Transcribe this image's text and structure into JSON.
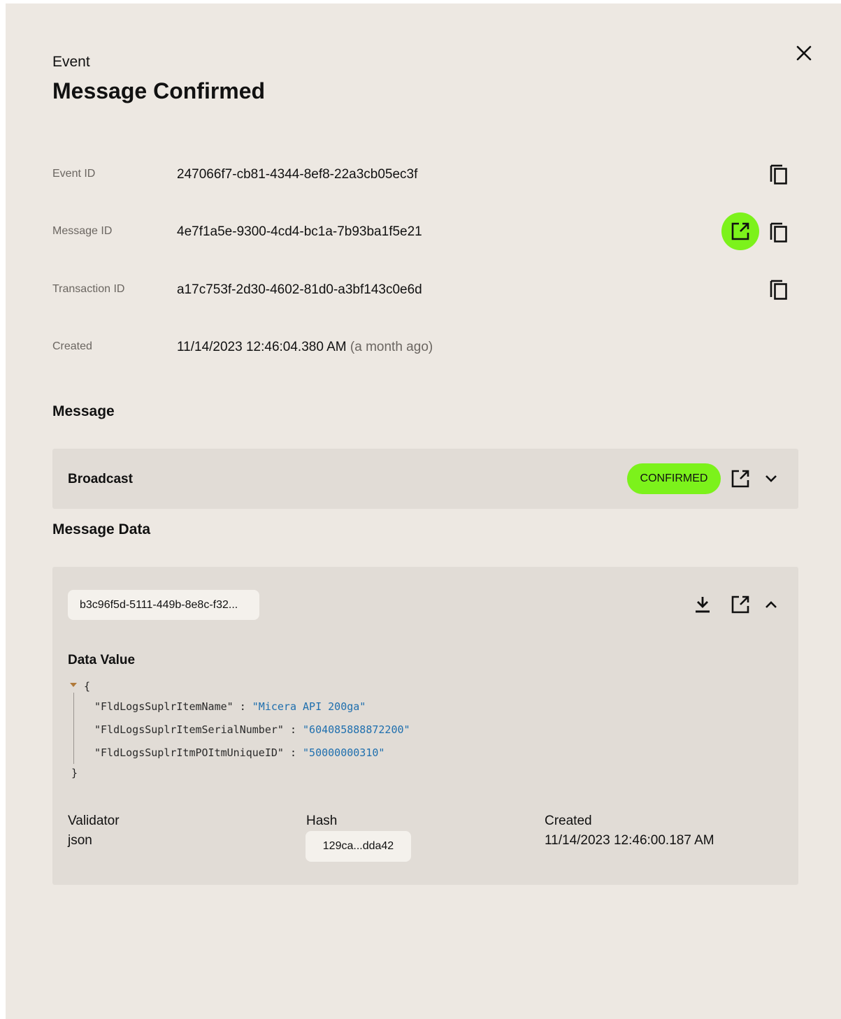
{
  "header": {
    "kicker": "Event",
    "title": "Message Confirmed"
  },
  "details": [
    {
      "label": "Event ID",
      "value": "247066f7-cb81-4344-8ef8-22a3cb05ec3f"
    },
    {
      "label": "Message ID",
      "value": "4e7f1a5e-9300-4cd4-bc1a-7b93ba1f5e21"
    },
    {
      "label": "Transaction ID",
      "value": "a17c753f-2d30-4602-81d0-a3bf143c0e6d"
    },
    {
      "label": "Created",
      "value": "11/14/2023 12:46:04.380 AM",
      "relative": "(a month ago)"
    }
  ],
  "message": {
    "section_title": "Message",
    "type": "Broadcast",
    "status": "CONFIRMED"
  },
  "message_data": {
    "section_title": "Message Data",
    "data_id": "b3c96f5d-5111-449b-8e8c-f32...",
    "data_value_title": "Data Value",
    "json_open": "{",
    "json_close": "}",
    "json_fields": [
      {
        "key": "\"FldLogsSuplrItemName\"",
        "sep": " : ",
        "value": "\"Micera API 200ga\""
      },
      {
        "key": "\"FldLogsSuplrItemSerialNumber\"",
        "sep": " : ",
        "value": "\"604085888872200\""
      },
      {
        "key": "\"FldLogsSuplrItmPOItmUniqueID\"",
        "sep": " : ",
        "value": "\"50000000310\""
      }
    ],
    "validator_label": "Validator",
    "validator_value": "json",
    "hash_label": "Hash",
    "hash_value": "129ca...dda42",
    "created_label": "Created",
    "created_value": "11/14/2023 12:46:00.187 AM"
  },
  "colors": {
    "panel_bg": "#ede8e2",
    "card_bg": "#e1dcd6",
    "accent": "#7cf21b",
    "json_string": "#1f6fae"
  },
  "icons": [
    "close-icon",
    "copy-icon",
    "open-external-icon",
    "chevron-down-icon",
    "chevron-up-icon",
    "download-icon",
    "json-collapse-icon"
  ]
}
